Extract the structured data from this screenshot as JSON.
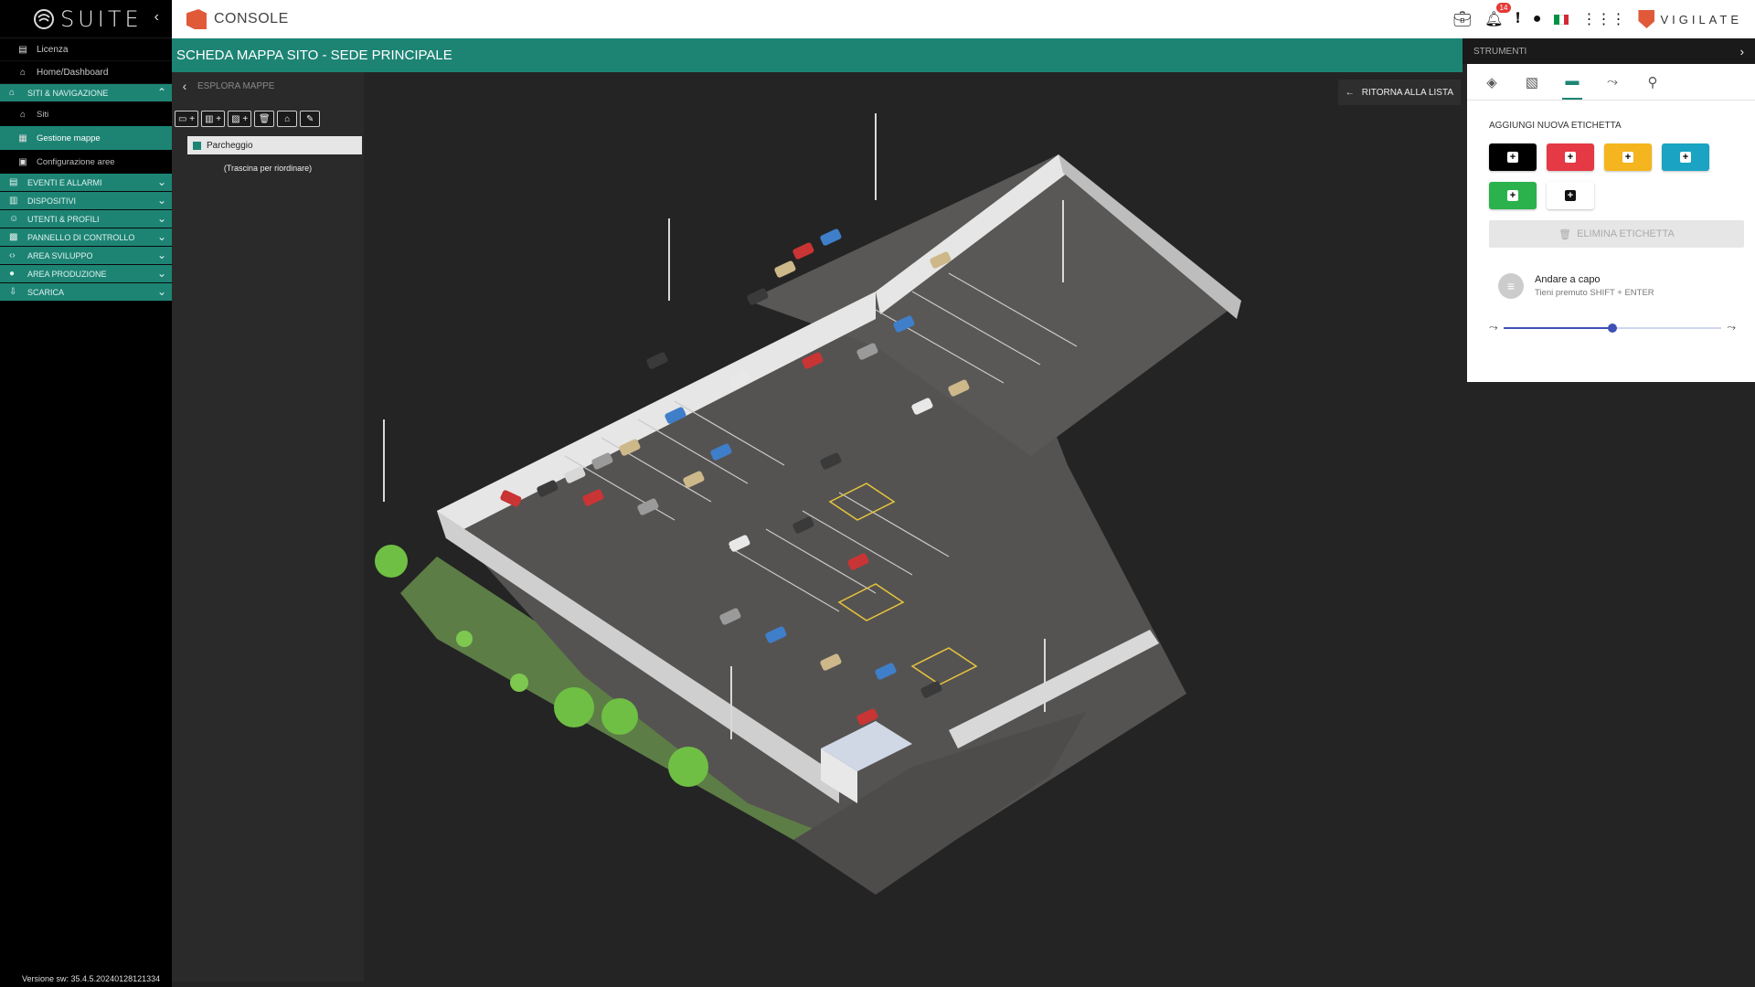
{
  "sidebar": {
    "brand": "SUITE",
    "items": [
      {
        "label": "Licenza",
        "icon": "id-card-icon"
      },
      {
        "label": "Home/Dashboard",
        "icon": "home-icon"
      }
    ],
    "section_sites": "SITI & NAVIGAZIONE",
    "sub_items": [
      {
        "label": "Siti",
        "icon": "home-outline-icon"
      },
      {
        "label": "Gestione mappe",
        "icon": "map-icon"
      },
      {
        "label": "Configurazione aree",
        "icon": "area-icon"
      }
    ],
    "sections": [
      "EVENTI E ALLARMI",
      "DISPOSITIVI",
      "UTENTI & PROFILI",
      "PANNELLO DI CONTROLLO",
      "AREA SVILUPPO",
      "AREA PRODUZIONE",
      "SCARICA"
    ],
    "version": "Versione sw: 35.4.5.20240128121334"
  },
  "topbar": {
    "title": "CONSOLE",
    "notification_count": "14",
    "brand": "VIGILATE"
  },
  "page": {
    "title": "SCHEDA MAPPA SITO - SEDE PRINCIPALE"
  },
  "explorer": {
    "title": "ESPLORA MAPPE",
    "tree_item": "Parcheggio",
    "drag_hint": "(Trascina per riordinare)"
  },
  "map": {
    "back_to_list": "RITORNA ALLA LISTA"
  },
  "tools": {
    "header": "STRUMENTI",
    "add_label_title": "AGGIUNGI NUOVA ETICHETTA",
    "swatch_colors": [
      "#000000",
      "#e53945",
      "#f4b51e",
      "#1aa3c2",
      "#2bb24c",
      "#ffffff"
    ],
    "delete_label": "ELIMINA ETICHETTA",
    "wrap_title": "Andare a capo",
    "wrap_hint": "Tieni premuto SHIFT + ENTER",
    "slider_value": 0.5
  }
}
